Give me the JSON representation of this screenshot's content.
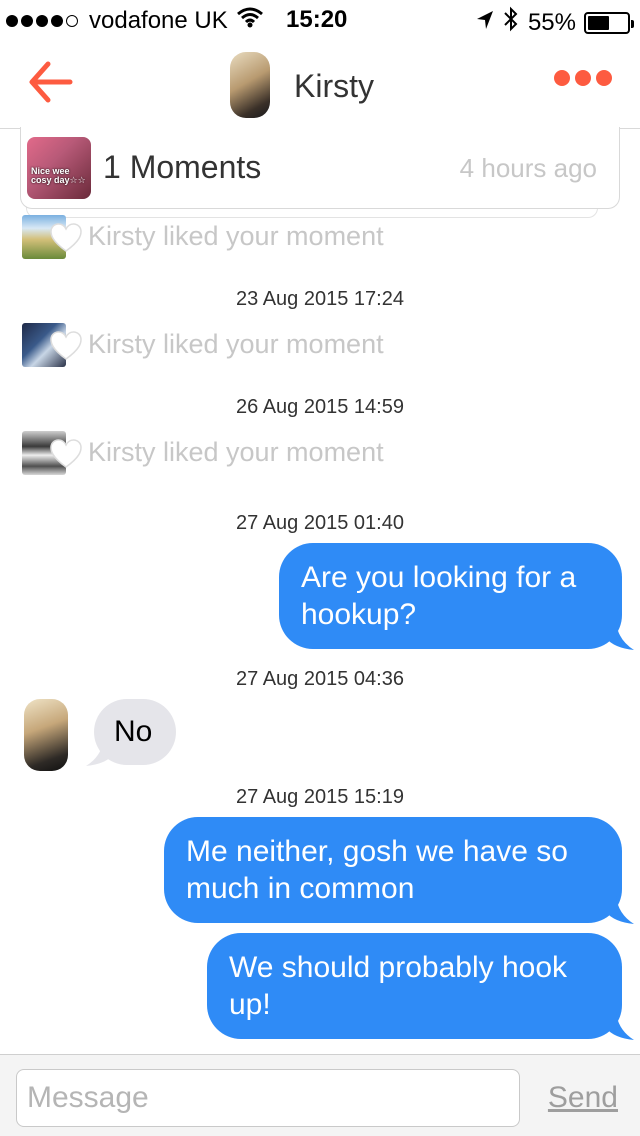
{
  "status_bar": {
    "carrier": "vodafone UK",
    "time": "15:20",
    "battery": "55%",
    "battery_level": 0.55,
    "signal_bars": 4,
    "icons": [
      "signal-dots-icon",
      "wifi-icon",
      "location-arrow-icon",
      "bluetooth-icon",
      "battery-icon"
    ]
  },
  "header": {
    "title": "Kirsty",
    "back_icon": "back-arrow-icon",
    "more_icon": "more-dots-icon",
    "accent": "#fd5b40"
  },
  "moments": {
    "label": "1 Moments",
    "time": "4 hours ago",
    "thumb_caption": "Nice wee cosy day☆☆"
  },
  "conversation": {
    "activity": [
      {
        "text": "Kirsty liked your moment"
      },
      {
        "text": "Kirsty liked your moment"
      },
      {
        "text": "Kirsty liked your moment"
      }
    ],
    "timestamps": [
      "23 Aug 2015 17:24",
      "26 Aug 2015 14:59",
      "27 Aug 2015 01:40",
      "27 Aug 2015 04:36",
      "27 Aug 2015 15:19"
    ],
    "messages": [
      {
        "from": "me",
        "text": "Are you looking for a hookup?"
      },
      {
        "from": "them",
        "text": "No"
      },
      {
        "from": "me",
        "text": "Me neither, gosh we have so much in common"
      },
      {
        "from": "me",
        "text": "We should probably hook up!"
      }
    ],
    "colors": {
      "outgoing": "#2f8bf6",
      "incoming": "#e5e5ea"
    }
  },
  "composer": {
    "placeholder": "Message",
    "value": "",
    "send_label": "Send"
  }
}
